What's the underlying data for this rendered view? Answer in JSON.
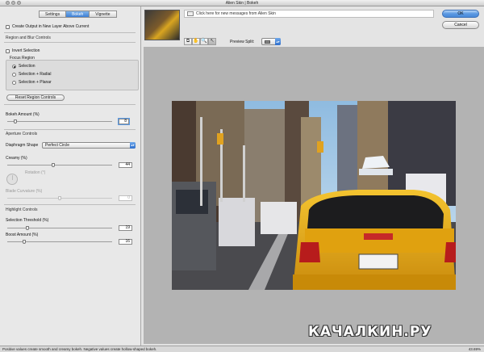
{
  "window": {
    "title": "Alien Skin | Bokeh"
  },
  "tabs": [
    {
      "label": "Settings",
      "active": false
    },
    {
      "label": "Bokeh",
      "active": true
    },
    {
      "label": "Vignette",
      "active": false
    }
  ],
  "panel": {
    "create_output_label": "Create Output in New Layer Above Current",
    "region_section": "Region and Blur Controls",
    "invert_selection_label": "Invert Selection",
    "focus_region_label": "Focus Region",
    "radio_options": [
      "Selection",
      "Selection + Radial",
      "Selection + Planar"
    ],
    "reset_button": "Reset Region Controls",
    "bokeh_amount_label": "Bokeh Amount (%)",
    "bokeh_amount_value": "8",
    "bokeh_amount_level": 0.08,
    "aperture_section": "Aperture Controls",
    "diaphragm_label": "Diaphragm Shape",
    "diaphragm_value": "Perfect Circle",
    "creamy_label": "Creamy (%)",
    "creamy_value": "44",
    "creamy_level": 0.44,
    "rotation_label": "Rotation (°)",
    "blade_label": "Blade Curvature (%)",
    "blade_value": "0",
    "highlight_section": "Highlight Controls",
    "threshold_label": "Selection Threshold (%)",
    "threshold_value": "19",
    "threshold_level": 0.19,
    "boost_label": "Boost Amount (%)",
    "boost_value": "16",
    "boost_level": 0.16
  },
  "top": {
    "notification": "Click here for new messages from Alien Skin",
    "preview_split_label": "Preview Split:",
    "ok": "OK",
    "cancel": "Cancel",
    "tools": [
      {
        "icon": "compare-icon",
        "glyph": "⧉"
      },
      {
        "icon": "hand-icon",
        "glyph": "✋"
      },
      {
        "icon": "zoom-icon",
        "glyph": "🔍"
      },
      {
        "icon": "pointer-icon",
        "glyph": "↖"
      }
    ]
  },
  "status": {
    "text": "Positive values create smooth and creamy bokeh. Negative values create hollow-shaped bokeh.",
    "zoom": "43.69%"
  },
  "watermark": "КАЧАЛКИН.РУ"
}
